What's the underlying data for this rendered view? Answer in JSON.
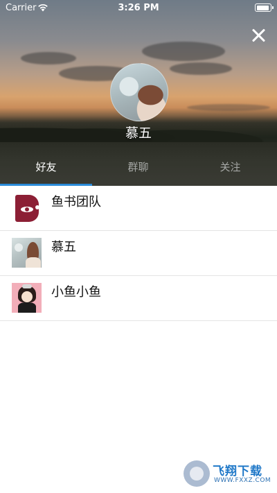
{
  "status_bar": {
    "carrier": "Carrier",
    "time": "3:26 PM"
  },
  "profile": {
    "name": "慕五"
  },
  "tabs": [
    {
      "label": "好友",
      "active": true
    },
    {
      "label": "群聊",
      "active": false
    },
    {
      "label": "关注",
      "active": false
    }
  ],
  "list": [
    {
      "label": "鱼书团队",
      "avatar": "brand-logo-b"
    },
    {
      "label": "慕五",
      "avatar": "photo-woman"
    },
    {
      "label": "小鱼小鱼",
      "avatar": "photo-girl"
    }
  ],
  "watermark": {
    "title": "飞翔下载",
    "url": "WWW.FXXZ.COM"
  },
  "colors": {
    "tab_indicator": "#2a8bd8",
    "tab_active": "#ffffff",
    "tab_inactive": "#a6a8a6",
    "divider": "#e4e4e4"
  }
}
